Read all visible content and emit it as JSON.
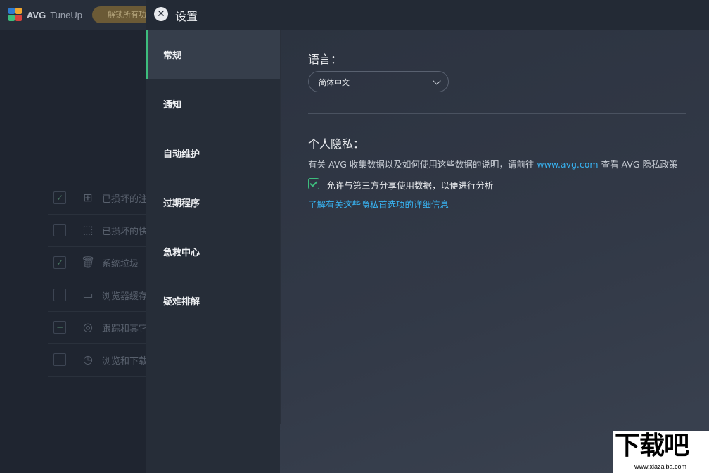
{
  "background_app": {
    "logo_brand": "AVG",
    "logo_product": "TuneUp",
    "unlock_button": "解锁所有功能",
    "list_items": [
      {
        "label": "已损坏的注",
        "checkbox": "✓",
        "icon": "apps-icon",
        "glyph": "⊞"
      },
      {
        "label": "已损坏的快",
        "checkbox": "",
        "icon": "shortcut-icon",
        "glyph": "⬚"
      },
      {
        "label": "系统垃圾",
        "checkbox": "✓",
        "icon": "trash-icon",
        "glyph": "🗑"
      },
      {
        "label": "浏览器缓存",
        "checkbox": "",
        "icon": "browser-icon",
        "glyph": "▭"
      },
      {
        "label": "跟踪和其它",
        "checkbox": "−",
        "icon": "target-icon",
        "glyph": "◎"
      },
      {
        "label": "浏览和下载",
        "checkbox": "",
        "icon": "history-icon",
        "glyph": "◷"
      }
    ]
  },
  "settings": {
    "close_glyph": "✕",
    "title": "设置",
    "nav": [
      {
        "label": "常规",
        "active": true
      },
      {
        "label": "通知",
        "active": false
      },
      {
        "label": "自动维护",
        "active": false
      },
      {
        "label": "过期程序",
        "active": false
      },
      {
        "label": "急救中心",
        "active": false
      },
      {
        "label": "疑难排解",
        "active": false
      }
    ],
    "general": {
      "language_heading": "语言：",
      "language_value": "简体中文",
      "privacy_heading": "个人隐私：",
      "privacy_desc_prefix": "有关 AVG 收集数据以及如何使用这些数据的说明，请前往 ",
      "privacy_desc_link": "www.avg.com",
      "privacy_desc_suffix": " 查看 AVG 隐私政策",
      "consent_label": "允许与第三方分享使用数据，以便进行分析",
      "consent_checked": true,
      "details_link": "了解有关这些隐私首选项的详细信息"
    }
  },
  "watermark": {
    "big": "下载吧",
    "small": "www.xiazaiba.com"
  },
  "colors": {
    "accent_green": "#3dbd7d",
    "link_blue": "#38b2f0"
  }
}
